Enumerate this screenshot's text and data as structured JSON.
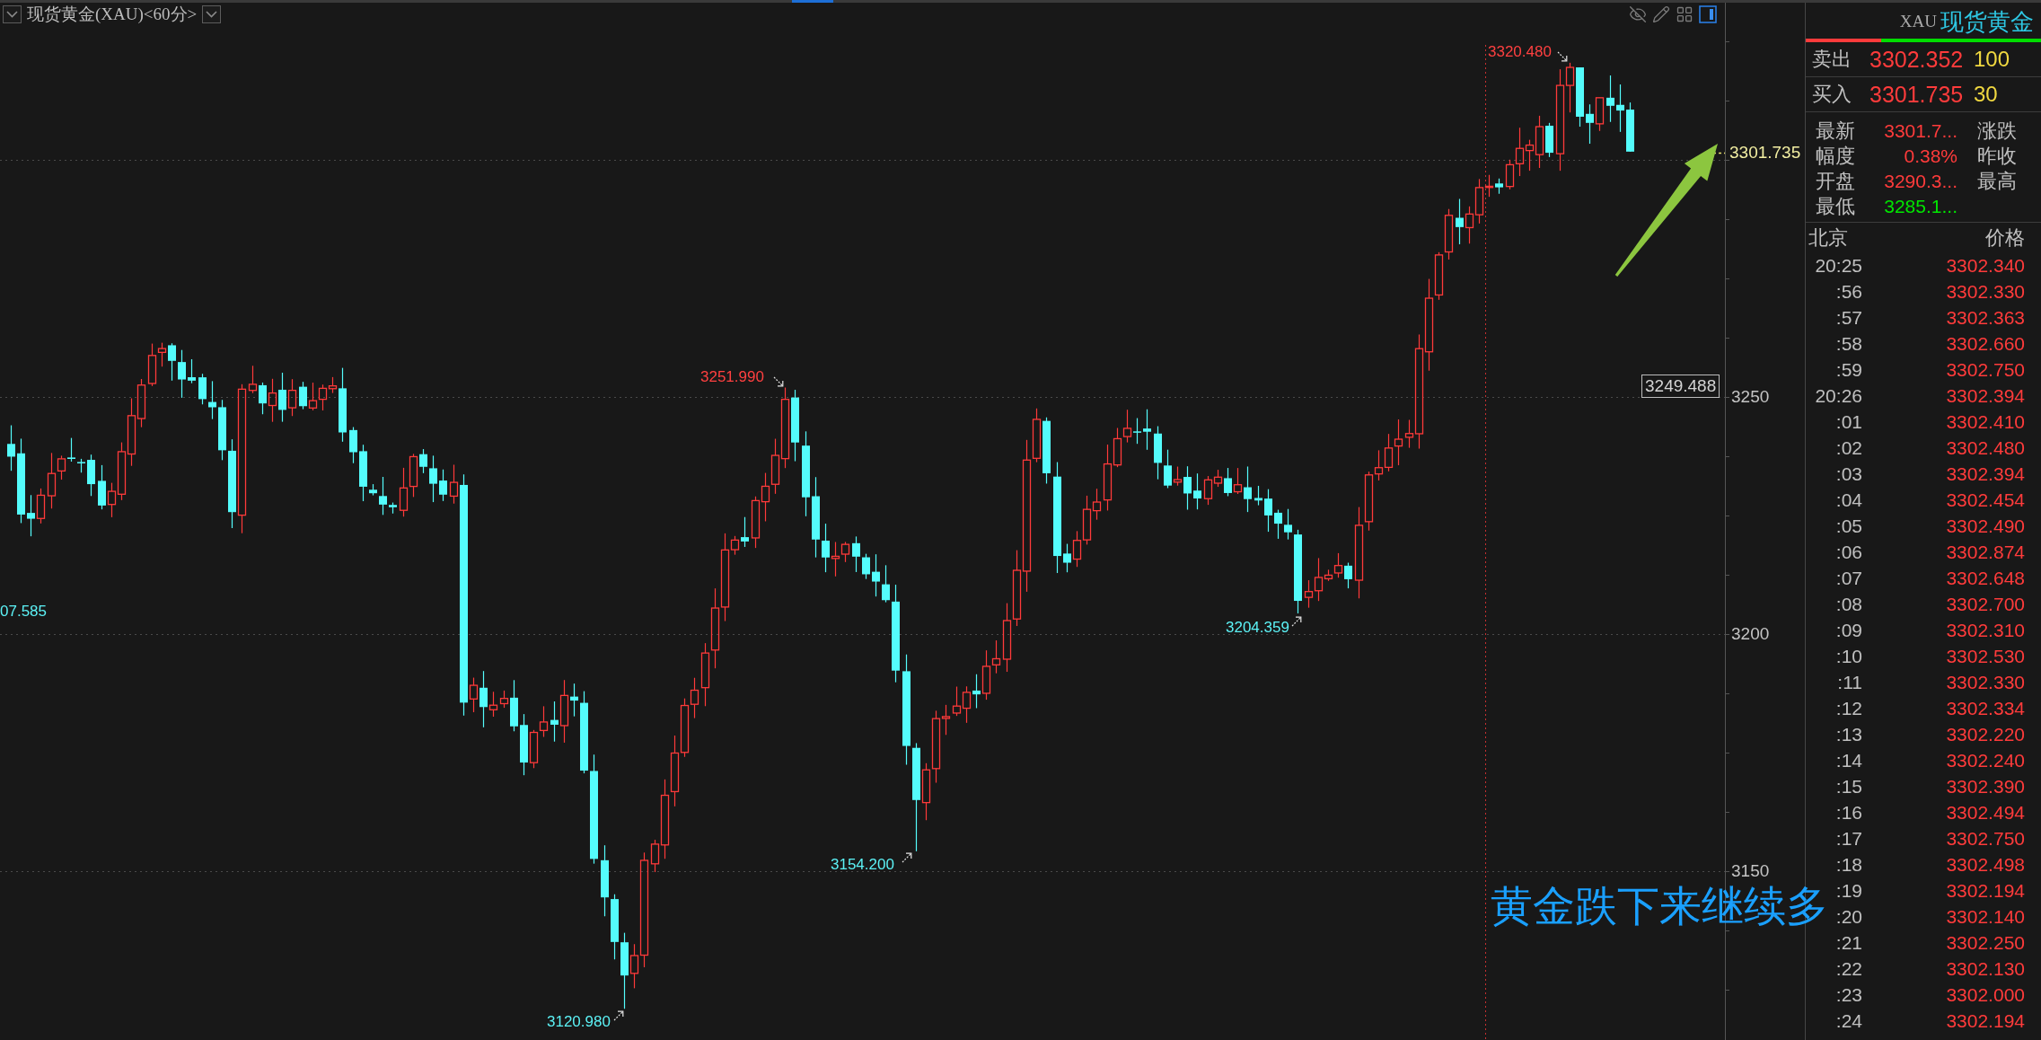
{
  "chart": {
    "title": "现货黄金(XAU)<60分>",
    "labels": [
      {
        "text": "3320.480",
        "kind": "high",
        "arrow": true
      },
      {
        "text": "3251.990",
        "kind": "high",
        "arrow": true
      },
      {
        "text": "07.585",
        "kind": "low",
        "arrow": false
      },
      {
        "text": "3204.359",
        "kind": "low",
        "arrow": true
      },
      {
        "text": "3154.200",
        "kind": "low",
        "arrow": true
      },
      {
        "text": "3120.980",
        "kind": "low",
        "arrow": true
      }
    ],
    "price_tag": "3249.488",
    "last_price": "3301.735",
    "y_ticks": [
      "3250",
      "3200",
      "3150"
    ]
  },
  "annotation": {
    "text": "黄金跌下来继续多"
  },
  "quote": {
    "symbol": "XAU",
    "name": "现货黄金",
    "ratio_bar": {
      "level": 0.32
    },
    "orders": [
      {
        "label": "卖出",
        "price": "3302.352",
        "volume": "100"
      },
      {
        "label": "买入",
        "price": "3301.735",
        "volume": "30"
      }
    ],
    "stats": [
      {
        "label": "最新",
        "value": "3301.7...",
        "color": "#ff3b3b"
      },
      {
        "label": "涨跌"
      },
      {
        "label": "幅度",
        "value": "0.38%",
        "color": "#ff3b3b"
      },
      {
        "label": "昨收"
      },
      {
        "label": "开盘",
        "value": "3290.3...",
        "color": "#ff3b3b"
      },
      {
        "label": "最高"
      },
      {
        "label": "最低",
        "value": "3285.1...",
        "color": "#00e600"
      }
    ],
    "ticks_header": {
      "time": "北京",
      "price": "价格"
    },
    "ticks": [
      {
        "time": "20:25",
        "price": "3302.340"
      },
      {
        "time": ":56",
        "price": "3302.330"
      },
      {
        "time": ":57",
        "price": "3302.363"
      },
      {
        "time": ":58",
        "price": "3302.660"
      },
      {
        "time": ":59",
        "price": "3302.750"
      },
      {
        "time": "20:26",
        "price": "3302.394"
      },
      {
        "time": ":01",
        "price": "3302.410"
      },
      {
        "time": ":02",
        "price": "3302.480"
      },
      {
        "time": ":03",
        "price": "3302.394"
      },
      {
        "time": ":04",
        "price": "3302.454"
      },
      {
        "time": ":05",
        "price": "3302.490"
      },
      {
        "time": ":06",
        "price": "3302.874"
      },
      {
        "time": ":07",
        "price": "3302.648"
      },
      {
        "time": ":08",
        "price": "3302.700"
      },
      {
        "time": ":09",
        "price": "3302.310"
      },
      {
        "time": ":10",
        "price": "3302.530"
      },
      {
        "time": ":11",
        "price": "3302.330"
      },
      {
        "time": ":12",
        "price": "3302.334"
      },
      {
        "time": ":13",
        "price": "3302.220"
      },
      {
        "time": ":14",
        "price": "3302.240"
      },
      {
        "time": ":15",
        "price": "3302.390"
      },
      {
        "time": ":16",
        "price": "3302.494"
      },
      {
        "time": ":17",
        "price": "3302.750"
      },
      {
        "time": ":18",
        "price": "3302.498"
      },
      {
        "time": ":19",
        "price": "3302.194"
      },
      {
        "time": ":20",
        "price": "3302.140"
      },
      {
        "time": ":21",
        "price": "3302.250"
      },
      {
        "time": ":22",
        "price": "3302.130"
      },
      {
        "time": ":23",
        "price": "3302.000"
      },
      {
        "time": ":24",
        "price": "3302.194"
      }
    ]
  }
}
